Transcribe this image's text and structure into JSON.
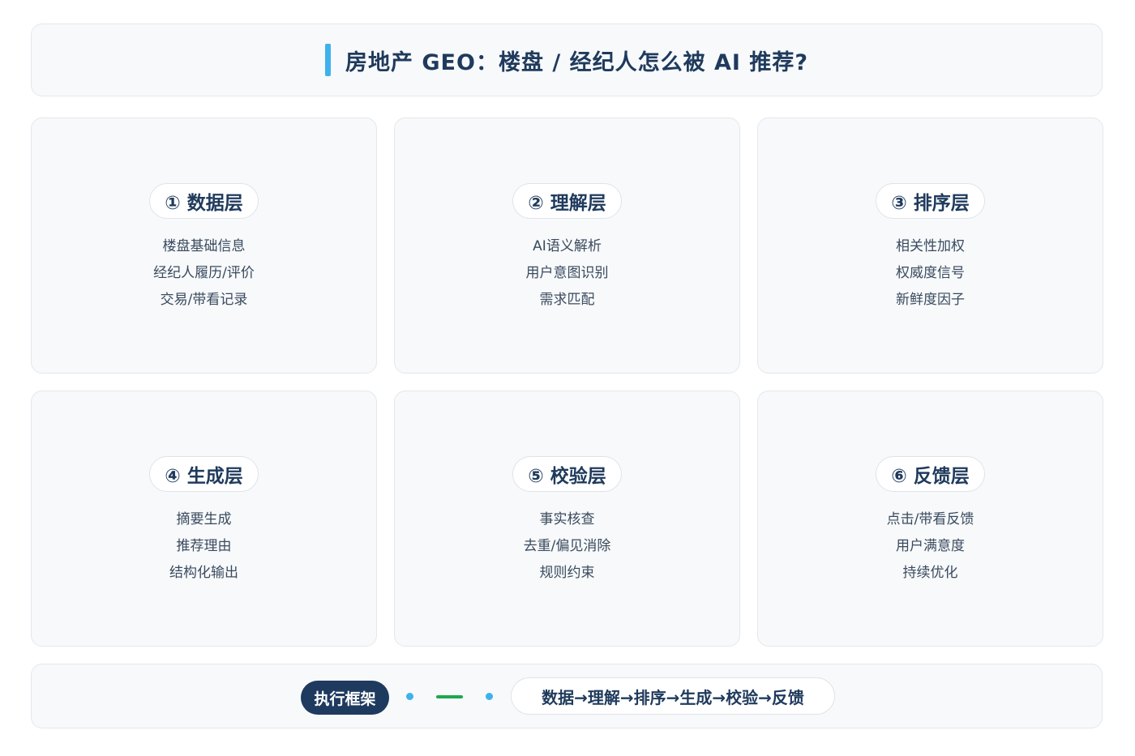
{
  "title": "房地产 GEO：楼盘 / 经纪人怎么被 AI 推荐?",
  "layers": [
    {
      "label": "① 数据层",
      "items": [
        "楼盘基础信息",
        "经纪人履历/评价",
        "交易/带看记录"
      ]
    },
    {
      "label": "② 理解层",
      "items": [
        "AI语义解析",
        "用户意图识别",
        "需求匹配"
      ]
    },
    {
      "label": "③ 排序层",
      "items": [
        "相关性加权",
        "权威度信号",
        "新鲜度因子"
      ]
    },
    {
      "label": "④ 生成层",
      "items": [
        "摘要生成",
        "推荐理由",
        "结构化输出"
      ]
    },
    {
      "label": "⑤ 校验层",
      "items": [
        "事实核查",
        "去重/偏见消除",
        "规则约束"
      ]
    },
    {
      "label": "⑥ 反馈层",
      "items": [
        "点击/带看反馈",
        "用户满意度",
        "持续优化"
      ]
    }
  ],
  "footer": {
    "badge": "执行框架",
    "flow": "数据→理解→排序→生成→校验→反馈"
  },
  "colors": {
    "accent": "#3fb1ec",
    "navy": "#1e3a5f",
    "green": "#1fa84f",
    "card_bg": "#f7f9fb"
  }
}
